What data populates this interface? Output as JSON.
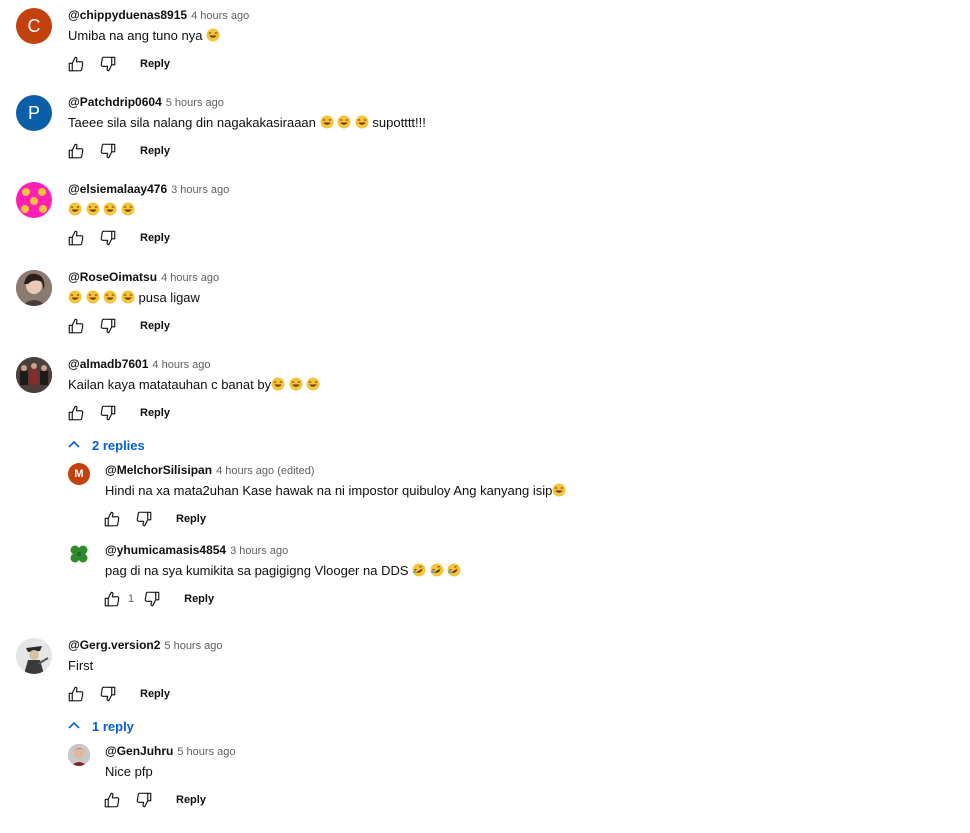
{
  "comments": [
    {
      "author": "@chippyduenas8915",
      "time": "4 hours ago",
      "text": "Umiba na ang tuno nya",
      "emojis": 1,
      "avatar_letter": "C",
      "avatar_color": "#c2410c",
      "reply_label": "Reply"
    },
    {
      "author": "@Patchdrip0604",
      "time": "5 hours ago",
      "text": "Taeee sila sila nalang din nagakakasiraaan",
      "emojis": 3,
      "after_emoji": " supotttt!!!",
      "avatar_letter": "P",
      "avatar_color": "#0b5ea8",
      "reply_label": "Reply"
    },
    {
      "author": "@elsiemalaay476",
      "time": "3 hours ago",
      "text": "",
      "emojis": 4,
      "avatar_color": "#ff1fb4",
      "reply_label": "Reply"
    },
    {
      "author": "@RoseOimatsu",
      "time": "4 hours ago",
      "text": "",
      "emojis": 4,
      "after_emoji": " pusa ligaw",
      "avatar_color": "#6b5a52",
      "reply_label": "Reply"
    },
    {
      "author": "@almadb7601",
      "time": "4 hours ago",
      "text": "Kailan kaya matatauhan c banat by",
      "emojis": 3,
      "avatar_color": "#3b2f2a",
      "reply_label": "Reply",
      "replies_toggle": "2 replies"
    },
    {
      "author": "@Gerg.version2",
      "time": "5 hours ago",
      "text": "First",
      "emojis": 0,
      "avatar_color": "#d9d9d9",
      "reply_label": "Reply",
      "replies_toggle": "1 reply"
    }
  ],
  "replies": [
    {
      "author": "@MelchorSilisipan",
      "time": "4 hours ago (edited)",
      "text": "Hindi na xa mata2uhan Kase hawak na ni impostor quibuloy Ang kanyang isip",
      "emojis": 1,
      "avatar_letter": "M",
      "avatar_color": "#c2410c",
      "reply_label": "Reply"
    },
    {
      "author": "@yhumicamasis4854",
      "time": "3 hours ago",
      "text": "pag di na sya kumikita sa pagigigng Vlooger na DDS",
      "emojis": 3,
      "emoji_type": "rofl",
      "like_count": "1",
      "avatar_color": "#2e8b2e",
      "reply_label": "Reply"
    },
    {
      "author": "@GenJuhru",
      "time": "5 hours ago",
      "text": "Nice pfp",
      "emojis": 0,
      "avatar_color": "#b33a2a",
      "reply_label": "Reply"
    }
  ]
}
